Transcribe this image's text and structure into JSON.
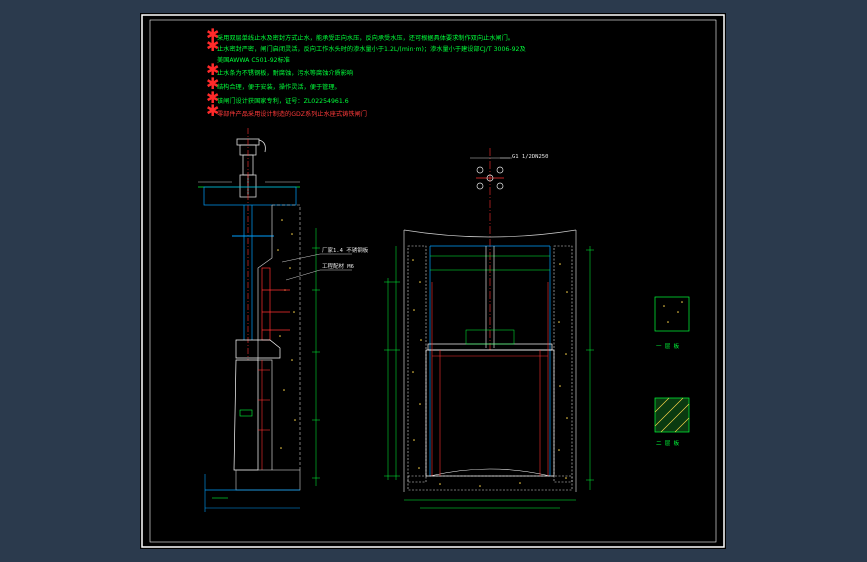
{
  "colors": {
    "background": "#2b3a4d",
    "sheet": "#000000",
    "border": "#ffffff",
    "bullet": "#ff2a2a",
    "note_text": "#00ff3a",
    "red_note": "#ff3a3a"
  },
  "notes": [
    "采用双层单线止水及密封方式止水，能承受正向水压，反向承受水压，还可根据具体要求制作双向止水闸门。",
    "止水密封严密，闸门启闭灵活，反向工作水头时的渗水量小于1.2L/(min·m)；渗水量小于建设部CJ/T 3006-92及",
    "美国AWWA C501-92标准",
    "止水条为不锈钢板，耐腐蚀，污水等腐蚀介质影响",
    "结构合理，便于安装，操作灵活，便于管理。",
    "该闸门设计获国家专利，证号：ZL02254961.6",
    "零部件产品采用设计制造的GDZ系列止水座式铸铁闸门"
  ],
  "callouts": {
    "plan_top": "G1 1/2DN250",
    "cover_plate": "厂家1.4 不锈钢板",
    "anchor": "工程配材 M6"
  },
  "legend": {
    "item1": "一 层 板",
    "item2": "二 层 板"
  }
}
